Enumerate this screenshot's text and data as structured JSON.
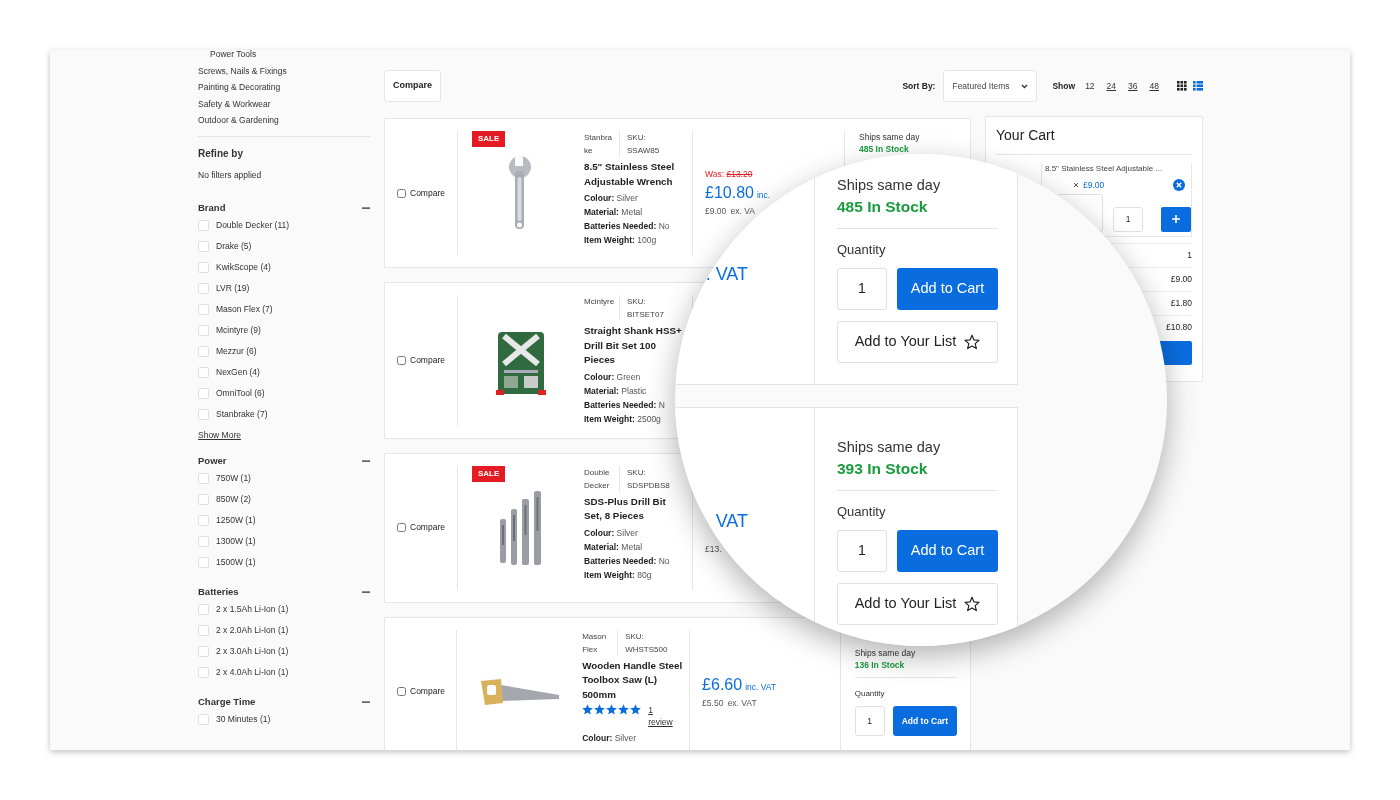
{
  "sidebar": {
    "categories": [
      {
        "label": "Power Tools",
        "kind": "sub"
      },
      {
        "label": "Screws, Nails & Fixings",
        "kind": "top"
      },
      {
        "label": "Painting & Decorating",
        "kind": "top"
      },
      {
        "label": "Safety & Workwear",
        "kind": "top"
      },
      {
        "label": "Outdoor & Gardening",
        "kind": "top"
      }
    ],
    "refine_title": "Refine by",
    "filter_status": "No filters applied",
    "facets": [
      {
        "title": "Brand",
        "expanded": true,
        "show_more": "Show More",
        "options": [
          {
            "label": "Double Decker (11)",
            "checked": false
          },
          {
            "label": "Drake (5)",
            "checked": false
          },
          {
            "label": "KwikScope (4)",
            "checked": false
          },
          {
            "label": "LVR (19)",
            "checked": false
          },
          {
            "label": "Mason Flex (7)",
            "checked": false
          },
          {
            "label": "Mcintyre (9)",
            "checked": false
          },
          {
            "label": "Mezzur (6)",
            "checked": false
          },
          {
            "label": "NexGen (4)",
            "checked": false
          },
          {
            "label": "OmniTool (6)",
            "checked": false
          },
          {
            "label": "Stanbrake (7)",
            "checked": false
          }
        ]
      },
      {
        "title": "Power",
        "expanded": true,
        "options": [
          {
            "label": "750W (1)",
            "checked": false
          },
          {
            "label": "850W (2)",
            "checked": false
          },
          {
            "label": "1250W (1)",
            "checked": false
          },
          {
            "label": "1300W (1)",
            "checked": false
          },
          {
            "label": "1500W (1)",
            "checked": false
          }
        ]
      },
      {
        "title": "Batteries",
        "expanded": true,
        "options": [
          {
            "label": "2 x 1.5Ah Li-Ion (1)",
            "checked": false
          },
          {
            "label": "2 x 2.0Ah Li-Ion (1)",
            "checked": false
          },
          {
            "label": "2 x 3.0Ah Li-Ion (1)",
            "checked": false
          },
          {
            "label": "2 x 4.0Ah Li-Ion (1)",
            "checked": false
          }
        ]
      },
      {
        "title": "Charge Time",
        "expanded": true,
        "options": [
          {
            "label": "30 Minutes (1)",
            "checked": false
          }
        ]
      }
    ]
  },
  "toolbar": {
    "compare": "Compare",
    "sort_label": "Sort By:",
    "sort_value": "Featured Items",
    "show_label": "Show",
    "page_sizes": [
      {
        "label": "12",
        "selected": true
      },
      {
        "label": "24",
        "selected": false
      },
      {
        "label": "36",
        "selected": false
      },
      {
        "label": "48",
        "selected": false
      }
    ],
    "views": [
      {
        "kind": "grid",
        "selected": false
      },
      {
        "kind": "list",
        "selected": true
      }
    ]
  },
  "products": [
    {
      "compare": {
        "label": "Compare",
        "checked": false
      },
      "badge": "SALE",
      "brand": "Stanbrake",
      "sku_label": "SKU:",
      "sku": "SSAW85",
      "name": "8.5\" Stainless Steel Adjustable Wrench",
      "attributes": [
        {
          "label": "Colour:",
          "value": "Silver"
        },
        {
          "label": "Material:",
          "value": "Metal"
        },
        {
          "label": "Batteries Needed:",
          "value": "No"
        },
        {
          "label": "Item Weight:",
          "value": "100g"
        }
      ],
      "price": {
        "was_label": "Was:",
        "was": "£13.20",
        "current": "£10.80",
        "inc_label": "inc.",
        "ex_price": "£9.00",
        "ex_label": "ex. VA"
      },
      "stock": {
        "ships": "Ships same day",
        "count": "485 In Stock"
      }
    },
    {
      "compare": {
        "label": "Compare",
        "checked": false
      },
      "brand": "Mcintyre",
      "sku_label": "SKU:",
      "sku": "BITSET07",
      "name": "Straight Shank HSS+ Drill Bit Set 100 Pieces",
      "attributes": [
        {
          "label": "Colour:",
          "value": "Green"
        },
        {
          "label": "Material:",
          "value": "Plastic"
        },
        {
          "label": "Batteries Needed:",
          "value": "N"
        },
        {
          "label": "Item Weight:",
          "value": "2500g"
        }
      ]
    },
    {
      "compare": {
        "label": "Compare",
        "checked": false
      },
      "badge": "SALE",
      "brand": "Double Decker",
      "sku_label": "SKU:",
      "sku": "SDSPDBS8",
      "name": "SDS-Plus Drill Bit Set, 8 Pieces",
      "attributes": [
        {
          "label": "Colour:",
          "value": "Silver"
        },
        {
          "label": "Material:",
          "value": "Metal"
        },
        {
          "label": "Batteries Needed:",
          "value": "No"
        },
        {
          "label": "Item Weight:",
          "value": "80g"
        }
      ],
      "price": {
        "ex_price": "£13."
      }
    },
    {
      "compare": {
        "label": "Compare",
        "checked": false
      },
      "brand": "Mason Flex",
      "sku_label": "SKU:",
      "sku": "WHSTS500",
      "name": "Wooden Handle Steel Toolbox Saw (L) 500mm",
      "stars": 5,
      "review_link": "1 review",
      "attributes": [
        {
          "label": "Colour:",
          "value": "Silver"
        }
      ],
      "price": {
        "current": "£6.60",
        "inc_label": "inc. VAT",
        "ex_price": "£5.50",
        "ex_label": "ex. VAT"
      },
      "stock": {
        "ships": "Ships same day",
        "count": "136 In Stock",
        "quantity_label": "Quantity",
        "qty": "1",
        "add_button": "Add to Cart"
      }
    }
  ],
  "cart": {
    "title": "Your Cart",
    "items": [
      {
        "name": "8.5\" Stainless Steel Adjustable ...",
        "price": "£9.00",
        "qty": "1"
      }
    ],
    "summary": [
      "1",
      "£9.00",
      "£1.80",
      "£10.80"
    ]
  },
  "magnifier": {
    "rows": [
      {
        "fragment": ". VAT",
        "ships": "Ships same day",
        "stock": "485 In Stock",
        "quantity_label": "Quantity",
        "qty": "1",
        "add_button": "Add to Cart",
        "list_button": "Add to Your List"
      },
      {
        "fragment": "VAT",
        "ships": "Ships same day",
        "stock": "393 In Stock",
        "quantity_label": "Quantity",
        "qty": "1",
        "add_button": "Add to Cart",
        "list_button": "Add to Your List"
      }
    ]
  }
}
